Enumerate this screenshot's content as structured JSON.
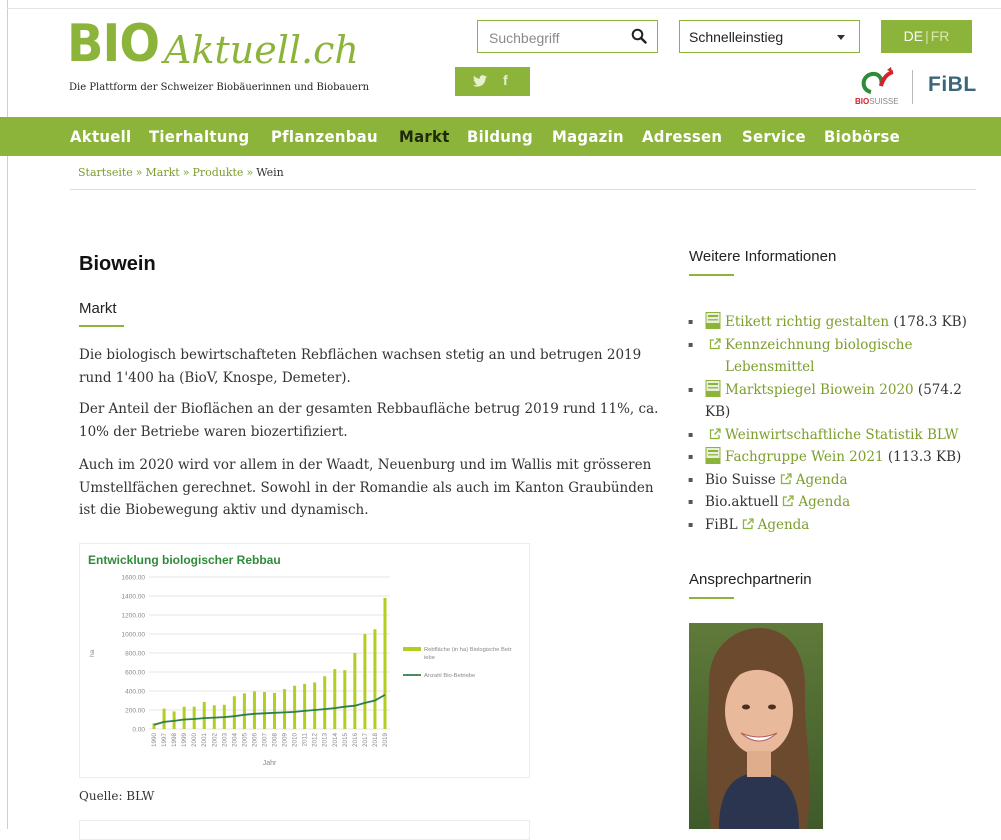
{
  "site": {
    "logo_big": "BIO",
    "logo_script": "Aktuell.ch",
    "tagline": "Die Plattform der Schweizer Biobäuerinnen und Biobauern"
  },
  "search": {
    "placeholder": "Suchbegriff"
  },
  "quick_access": {
    "value": "Schnelleinstieg"
  },
  "language": {
    "de": "DE",
    "sep": "|",
    "fr": "FR"
  },
  "social": {
    "twitter": "𝕥",
    "facebook": "f"
  },
  "partners": {
    "biosuisse_bio": "BIO",
    "biosuisse_rest": "SUISSE",
    "fibl": "FiBL"
  },
  "nav": {
    "items": [
      {
        "label": "Aktuell"
      },
      {
        "label": "Tierhaltung"
      },
      {
        "label": "Pflanzenbau"
      },
      {
        "label": "Markt"
      },
      {
        "label": "Bildung"
      },
      {
        "label": "Magazin"
      },
      {
        "label": "Adressen"
      },
      {
        "label": "Service"
      },
      {
        "label": "Biobörse"
      }
    ]
  },
  "breadcrumb": {
    "home": "Startseite",
    "markt": "Markt",
    "produkte": "Produkte",
    "current": "Wein",
    "sep": "»"
  },
  "main": {
    "title": "Biowein",
    "subtitle": "Markt",
    "p1": "Die biologisch bewirtschafteten Rebflächen wachsen stetig an und betrugen 2019 rund 1'400 ha (BioV, Knospe, Demeter).",
    "p2": "Der Anteil der Bioflächen an der gesamten Rebbaufläche betrug 2019 rund 11%, ca. 10% der Betriebe waren biozertifiziert.",
    "p3": "Auch im 2020 wird vor allem in der Waadt, Neuenburg und im Wallis mit grösseren Umstellfächen gerechnet. Sowohl in der Romandie als auch im Kanton Graubünden ist die Biobewegung aktiv und dynamisch.",
    "source": "Quelle: BLW"
  },
  "chart_data": {
    "type": "bar",
    "title": "Entwicklung biologischer Rebbau",
    "xlabel": "Jahr",
    "ylabel": "ha",
    "ylim": [
      0,
      1600
    ],
    "yticks": [
      "1600.00",
      "1400.00",
      "1200.00",
      "1000.00",
      "800.00",
      "600.00",
      "400.00",
      "200.00",
      "0.00"
    ],
    "categories": [
      "1990",
      "1997",
      "1998",
      "1999",
      "2000",
      "2001",
      "2002",
      "2003",
      "2004",
      "2005",
      "2006",
      "2007",
      "2008",
      "2009",
      "2010",
      "2011",
      "2012",
      "2013",
      "2014",
      "2015",
      "2016",
      "2017",
      "2018",
      "2019"
    ],
    "series": [
      {
        "name": "Rebfläche (in ha) Biologische Betriebe",
        "kind": "bar",
        "color": "#b5cc21",
        "values": [
          60,
          215,
          185,
          235,
          235,
          285,
          250,
          255,
          345,
          375,
          395,
          390,
          380,
          420,
          455,
          475,
          490,
          555,
          630,
          620,
          800,
          1000,
          1050,
          1380
        ]
      },
      {
        "name": "Anzahl Bio-Betriebe",
        "kind": "line",
        "color": "#2f7d4a",
        "values": [
          45,
          75,
          85,
          100,
          105,
          115,
          120,
          125,
          135,
          150,
          160,
          165,
          170,
          175,
          180,
          190,
          200,
          210,
          220,
          235,
          245,
          275,
          300,
          360
        ]
      }
    ],
    "legend": "right"
  },
  "sidebar": {
    "more_info_title": "Weitere Informationen",
    "links": [
      {
        "text": "Etikett richtig gestalten",
        "size": "(178.3 KB)",
        "icon": "pdf-icon"
      },
      {
        "text": "Kennzeichnung biologische Lebensmittel",
        "icon": "external-link-icon"
      },
      {
        "text": "Marktspiegel Biowein 2020",
        "size": "(574.2 KB)",
        "icon": "pdf-icon"
      },
      {
        "text": "Weinwirtschaftliche Statistik BLW",
        "icon": "external-link-icon"
      },
      {
        "text": "Fachgruppe Wein 2021",
        "size": "(113.3 KB)",
        "icon": "pdf-icon"
      },
      {
        "prefix": "Bio Suisse",
        "text": "Agenda",
        "icon": "external-link-icon"
      },
      {
        "prefix": "Bio.aktuell",
        "text": "Agenda",
        "icon": "external-link-icon"
      },
      {
        "prefix": "FiBL",
        "text": "Agenda",
        "icon": "external-link-icon"
      }
    ],
    "contact_title": "Ansprechpartnerin"
  }
}
